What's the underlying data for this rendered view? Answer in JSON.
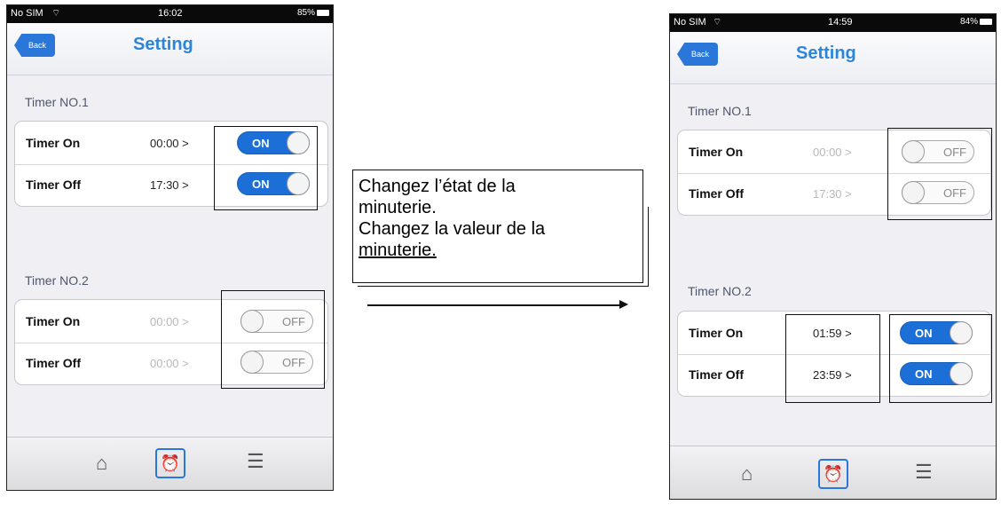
{
  "left_screen": {
    "status": {
      "carrier": "No SIM",
      "time": "16:02",
      "battery": "85%"
    },
    "nav": {
      "back_label": "Back",
      "title": "Setting"
    },
    "timer1": {
      "label": "Timer NO.1",
      "rows": [
        {
          "label": "Timer On",
          "value": "00:00 >",
          "toggle": "ON"
        },
        {
          "label": "Timer Off",
          "value": "17:30 >",
          "toggle": "ON"
        }
      ]
    },
    "timer2": {
      "label": "Timer NO.2",
      "rows": [
        {
          "label": "Timer On",
          "value": "00:00 >",
          "toggle": "OFF"
        },
        {
          "label": "Timer Off",
          "value": "00:00 >",
          "toggle": "OFF"
        }
      ]
    },
    "tabs": [
      "home-icon",
      "alarm-clock-icon",
      "list-icon"
    ]
  },
  "right_screen": {
    "status": {
      "carrier": "No SIM",
      "time": "14:59",
      "battery": "84%"
    },
    "nav": {
      "back_label": "Back",
      "title": "Setting"
    },
    "timer1": {
      "label": "Timer NO.1",
      "rows": [
        {
          "label": "Timer On",
          "value": "00:00 >",
          "toggle": "OFF"
        },
        {
          "label": "Timer Off",
          "value": "17:30 >",
          "toggle": "OFF"
        }
      ]
    },
    "timer2": {
      "label": "Timer NO.2",
      "rows": [
        {
          "label": "Timer On",
          "value": "01:59 >",
          "toggle": "ON"
        },
        {
          "label": "Timer Off",
          "value": "23:59 >",
          "toggle": "ON"
        }
      ]
    },
    "tabs": [
      "home-icon",
      "alarm-clock-icon",
      "list-icon"
    ]
  },
  "callout": {
    "line1": "Changez l’état de la",
    "line2": "minuterie.",
    "line3": "Changez la valeur de la",
    "line4": "minuterie."
  },
  "colors": {
    "accent": "#2b86d9",
    "toggle_on": "#1b6fd6"
  }
}
